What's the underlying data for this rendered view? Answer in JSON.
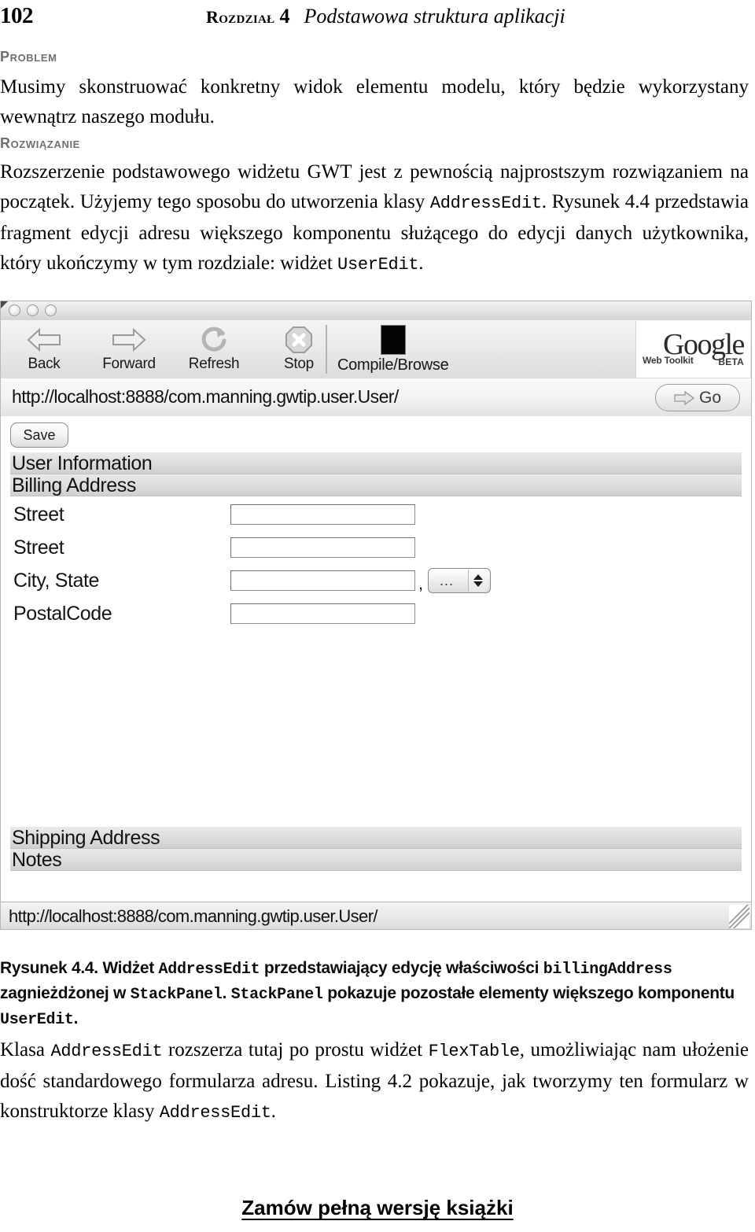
{
  "page": {
    "folio": "102",
    "chapter_label": "Rozdział",
    "chapter_number": "4",
    "chapter_title": "Podstawowa struktura aplikacji"
  },
  "sections": {
    "problem_label": "Problem",
    "problem_text": "Musimy skonstruować konkretny widok elementu modelu, który będzie wykorzystany wewnątrz naszego modułu.",
    "solution_label": "Rozwiązanie",
    "solution_text_1": "Rozszerzenie podstawowego widżetu GWT jest z pewnością najprostszym rozwiązaniem na początek. Użyjemy tego sposobu do utworzenia klasy ",
    "solution_code_1": "AddressEdit",
    "solution_text_2": ". Rysunek 4.4 przedstawia fragment edycji adresu większego komponentu służącego do edycji danych użytkownika, który ukończymy w tym rozdziale: widżet ",
    "solution_code_2": "UserEdit",
    "solution_text_3": "."
  },
  "browser": {
    "toolbar": {
      "back": "Back",
      "forward": "Forward",
      "refresh": "Refresh",
      "stop": "Stop",
      "compile_browse": "Compile/Browse"
    },
    "logo": {
      "google": "Google",
      "web_toolkit": "Web Toolkit",
      "beta": "BETA"
    },
    "url": "http://localhost:8888/com.manning.gwtip.user.User/",
    "go_label": "Go",
    "status_url": "http://localhost:8888/com.manning.gwtip.user.User/"
  },
  "app": {
    "save_label": "Save",
    "stack_panels_top": [
      "User Information",
      "Billing Address"
    ],
    "stack_panels_bottom": [
      "Shipping Address",
      "Notes"
    ],
    "form_rows": [
      {
        "label": "Street",
        "value": ""
      },
      {
        "label": "Street",
        "value": ""
      },
      {
        "label": "City, State",
        "value": ""
      },
      {
        "label": "PostalCode",
        "value": ""
      }
    ],
    "state_select": {
      "value": "...",
      "separator": ","
    }
  },
  "caption": {
    "prefix": "Rysunek 4.4. Widżet ",
    "code_1": "AddressEdit",
    "mid_1": " przedstawiający edycję właściwości ",
    "code_2": "billingAddress",
    "mid_2": " zagnieżdżonej w ",
    "code_3": "StackPanel",
    "mid_3": ". ",
    "code_4": "StackPanel",
    "mid_4": " pokazuje pozostałe elementy większego komponentu ",
    "code_5": "UserEdit",
    "suffix": "."
  },
  "body_after": {
    "t1": "Klasa ",
    "c1": "AddressEdit",
    "t2": " rozszerza tutaj po prostu widżet ",
    "c2": "FlexTable",
    "t3": ", umożliwiając nam ułożenie dość standardowego formularza adresu. Listing 4.2 pokazuje, jak tworzymy ten formularz w konstruktorze klasy ",
    "c3": "AddressEdit",
    "t4": "."
  },
  "footer": {
    "order_link": "Zamów pełną wersję książki"
  }
}
